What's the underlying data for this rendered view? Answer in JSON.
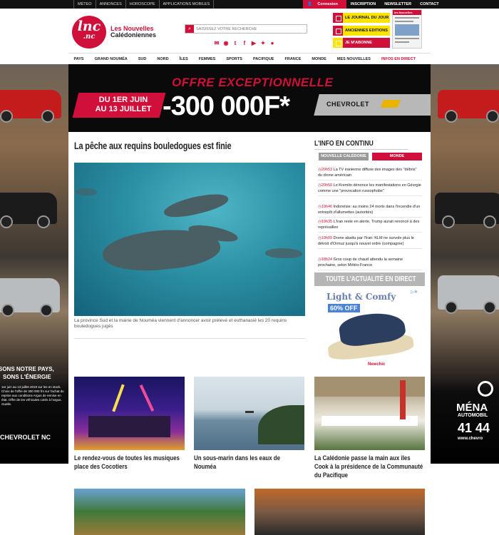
{
  "topbar": {
    "left_links": [
      "MÉTEO",
      "ANNONCES",
      "HOROSCOPE",
      "APPLICATIONS MOBILES"
    ],
    "login": "Connexion",
    "right_links": [
      "INSCRIPTION",
      "NEWSLETTER",
      "CONTACT"
    ]
  },
  "header": {
    "logo_line1": "lnc",
    "logo_line2": ".nc",
    "brand_line1": "Les Nouvelles",
    "brand_line2": "Calédoniennes",
    "search_placeholder": "SAISISSEZ VOTRE RECHERCHE",
    "buttons": [
      "LE JOURNAL DU JOUR",
      "ANCIENNES EDITIONS",
      "JE M'ABONNE"
    ],
    "newspaper_masthead": "les Nouvelles"
  },
  "nav": [
    "PAYS",
    "GRAND NOUMÉA",
    "SUD",
    "NORD",
    "ÎLES",
    "FEMMES",
    "SPORTS",
    "PACIFIQUE",
    "FRANCE",
    "MONDE",
    "MES NOUVELLES",
    "INFOS EN DIRECT"
  ],
  "banner": {
    "headline": "OFFRE EXCEPTIONNELLE",
    "dates_line1": "DU 1ER JUIN",
    "dates_line2": "AU 13 JUILLET",
    "amount": "-300 000F*",
    "brand": "CHEVROLET"
  },
  "side_ads": {
    "left_text1": "SONS NOTRE PAYS,",
    "left_text2": "SONS L'ÉNERGIE",
    "left_small": "1er juin au 13 juillet 2019 sur les en stock. Choix de l'offre de 300 000 frs sur l'achat du reprise aux conditions Argus de remise en état. Offre de les véhicules cotés à l'argus. ctuelle.",
    "left_brand": "CHEVROLET NC",
    "right_text1": "MÉNA",
    "right_text2": "AUTOMOBIL",
    "right_phone": "41 44",
    "right_url": "www.chevro"
  },
  "main": {
    "headline": "La pêche aux requins bouledogues est finie",
    "caption": "La province Sud et la mairie de Nouméa viennent d'annoncer avoir prélevé et euthanasié les 20 requins bouledogues jugés"
  },
  "info": {
    "title": "L'INFO EN CONTINU",
    "tab_nc": "NOUVELLE CALÉDONIE",
    "tab_monde": "MONDE",
    "items": [
      {
        "time": "20h53",
        "text": "La TV iranienne diffuse des images des \"débris\" du drone américain"
      },
      {
        "time": "20h50",
        "text": "Le Kremlin dénonce les manifestations en Géorgie comme une \"provocation russophobe\""
      },
      {
        "time": "19h46",
        "text": "Indonésie: au moins 24 morts dans l'incendie d'un entrepôt d'allumettes (autorités)"
      },
      {
        "time": "19h35",
        "text": "L'Iran reste en alerte, Trump aurait renoncé à des représailles"
      },
      {
        "time": "19h09",
        "text": "Drone abattu par l'Iran: KLM ne survole plus le détroit d'Ormuz jusqu'à nouvel ordre (compagnie)"
      },
      {
        "time": "18h24",
        "text": "Gros coup de chaud attendu la semaine prochaine, selon Météo-France"
      }
    ],
    "button": "TOUTE L'ACTUALITÉ EN DIRECT"
  },
  "ad_sandal": {
    "line1": "Light & Comfy",
    "line2": "60% OFF",
    "brand": "Newchic"
  },
  "cards": [
    {
      "title": "Le rendez-vous de toutes les musiques place des Cocotiers"
    },
    {
      "title": "Un sous-marin dans les eaux de Nouméa"
    },
    {
      "title": "La Calédonie passe la main aux îles Cook à la présidence de la Communauté du Pacifique"
    }
  ]
}
